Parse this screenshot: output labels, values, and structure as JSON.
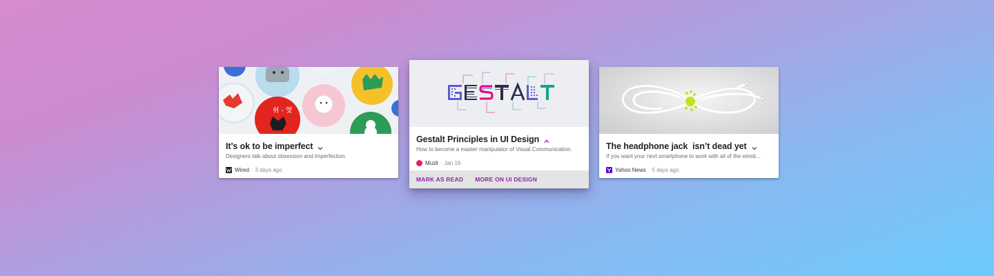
{
  "cards": [
    {
      "title": "It’s ok to be imperfect",
      "description": "Designers talk about obsession and imperfection.",
      "source": "Wired",
      "date": "3 days ago",
      "expand_icon": "chevron-down-icon",
      "source_icon": "wired-logo-icon",
      "image": "pin-badges-image"
    },
    {
      "title": "Gestalt Principles in UI Design",
      "description": "How to become a master manipulator of Visual Communication.",
      "source": "Muzli",
      "date": "Jan 16",
      "expand_icon": "chevron-up-icon",
      "source_icon": "muzli-logo-icon",
      "image": "gestalt-lettering-image",
      "image_text": "GESTALT",
      "actions": [
        "MARK AS READ",
        "MORE ON UI DESIGN"
      ]
    },
    {
      "title": "The headphone jack  isn’t dead yet",
      "description": "If you want your next smartphone to work with all of the wired...",
      "source": "Yahoo News",
      "date": "5 days ago",
      "expand_icon": "chevron-down-icon",
      "source_icon": "yahoo-logo-icon",
      "image": "headphone-cable-image"
    }
  ],
  "meta_separator": "·",
  "colors": {
    "accent": "#8e24aa",
    "muzli": "#e91e63",
    "yahoo": "#5f01d1",
    "actions_bar": "#e4e4e4"
  }
}
